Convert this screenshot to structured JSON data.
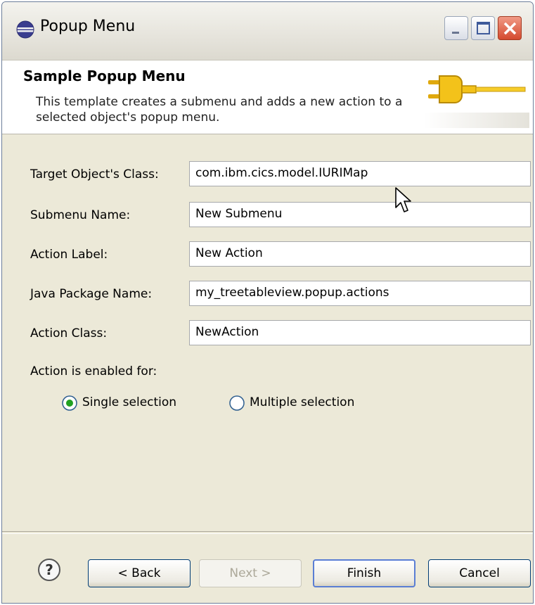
{
  "window": {
    "title": "Popup Menu"
  },
  "banner": {
    "title": "Sample Popup Menu",
    "description": "This template creates a submenu and adds a new action to a selected object's popup menu."
  },
  "form": {
    "fields": [
      {
        "label": "Target Object's Class:",
        "value": "com.ibm.cics.model.IURIMap"
      },
      {
        "label": "Submenu Name:",
        "value": "New Submenu"
      },
      {
        "label": "Action Label:",
        "value": "New Action"
      },
      {
        "label": "Java Package Name:",
        "value": "my_treetableview.popup.actions"
      },
      {
        "label": "Action Class:",
        "value": "NewAction"
      }
    ],
    "enabled_for_label": "Action is enabled for:",
    "radios": [
      {
        "label": "Single selection",
        "selected": true
      },
      {
        "label": "Multiple selection",
        "selected": false
      }
    ]
  },
  "buttons": {
    "back": "< Back",
    "next": "Next >",
    "finish": "Finish",
    "cancel": "Cancel"
  },
  "icons": {
    "app": "eclipse-icon",
    "banner": "plug-icon",
    "help": "help-icon"
  }
}
